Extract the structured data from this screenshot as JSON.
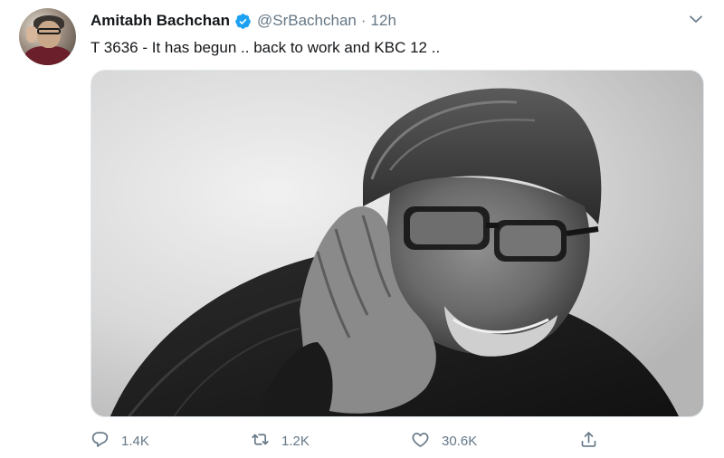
{
  "tweet": {
    "author": {
      "name": "Amitabh Bachchan",
      "handle": "@SrBachchan",
      "verified": true
    },
    "separator": "·",
    "time": "12h",
    "text": "T 3636 - It has begun .. back to work and KBC 12 ..",
    "media": {
      "type": "photo",
      "style": "black-and-white portrait"
    },
    "stats": {
      "replies": "1.4K",
      "retweets": "1.2K",
      "likes": "30.6K"
    }
  },
  "icons": {
    "verified": "verified-badge-icon",
    "more": "chevron-down-icon",
    "reply": "reply-icon",
    "retweet": "retweet-icon",
    "like": "heart-icon",
    "share": "share-icon"
  },
  "colors": {
    "verified": "#1da1f2",
    "secondary_text": "#657786",
    "primary_text": "#14171a"
  }
}
